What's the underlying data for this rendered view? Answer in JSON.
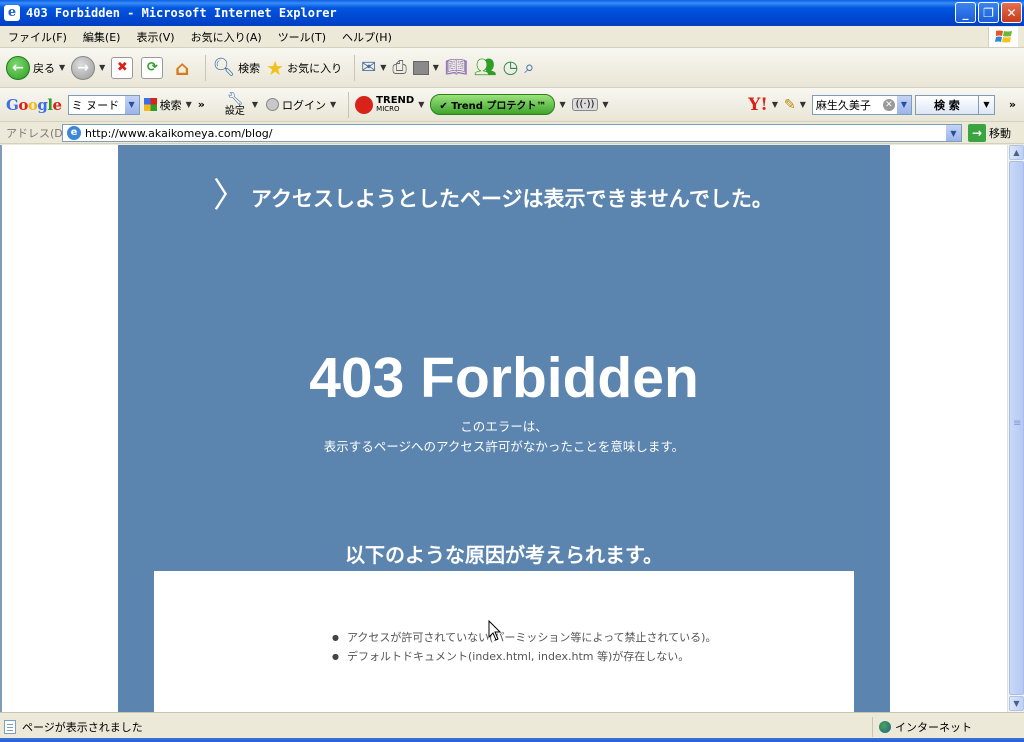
{
  "window": {
    "title": "403 Forbidden - Microsoft Internet Explorer",
    "controls": [
      "_",
      "❐",
      "✕"
    ]
  },
  "menu": [
    "ファイル(F)",
    "編集(E)",
    "表示(V)",
    "お気に入り(A)",
    "ツール(T)",
    "ヘルプ(H)"
  ],
  "toolbar": {
    "back_label": "戻る",
    "search_label": "検索",
    "favorites_label": "お気に入り"
  },
  "google_bar": {
    "logo": "Google",
    "query_value": "ミ ヌード",
    "search_label": "検索",
    "settings_label": "設定",
    "login_label": "ログイン",
    "trend_label": "TREND",
    "trend_sub": "MICRO",
    "trend_protect_label": "Trend プロテクト™",
    "yahoo_logo": "Y!",
    "yahoo_query_value": "麻生久美子",
    "yahoo_search_label": "検 索"
  },
  "address": {
    "label": "アドレス(D)",
    "url": "http://www.akaikomeya.com/blog/",
    "go_label": "移動"
  },
  "page": {
    "heading": "アクセスしようとしたページは表示できませんでした。",
    "error_code_title": "403 Forbidden",
    "desc_line1": "このエラーは、",
    "desc_line2": "表示するページへのアクセス許可がなかったことを意味します。",
    "reasons_heading": "以下のような原因が考えられます。",
    "reasons": [
      "アクセスが許可されていない(パーミッション等によって禁止されている)。",
      "デフォルトドキュメント(index.html, index.htm 等)が存在しない。"
    ]
  },
  "status": {
    "message": "ページが表示されました",
    "zone": "インターネット"
  },
  "colors": {
    "panel": "#5B84AE",
    "titlebar": "#0047D0"
  }
}
